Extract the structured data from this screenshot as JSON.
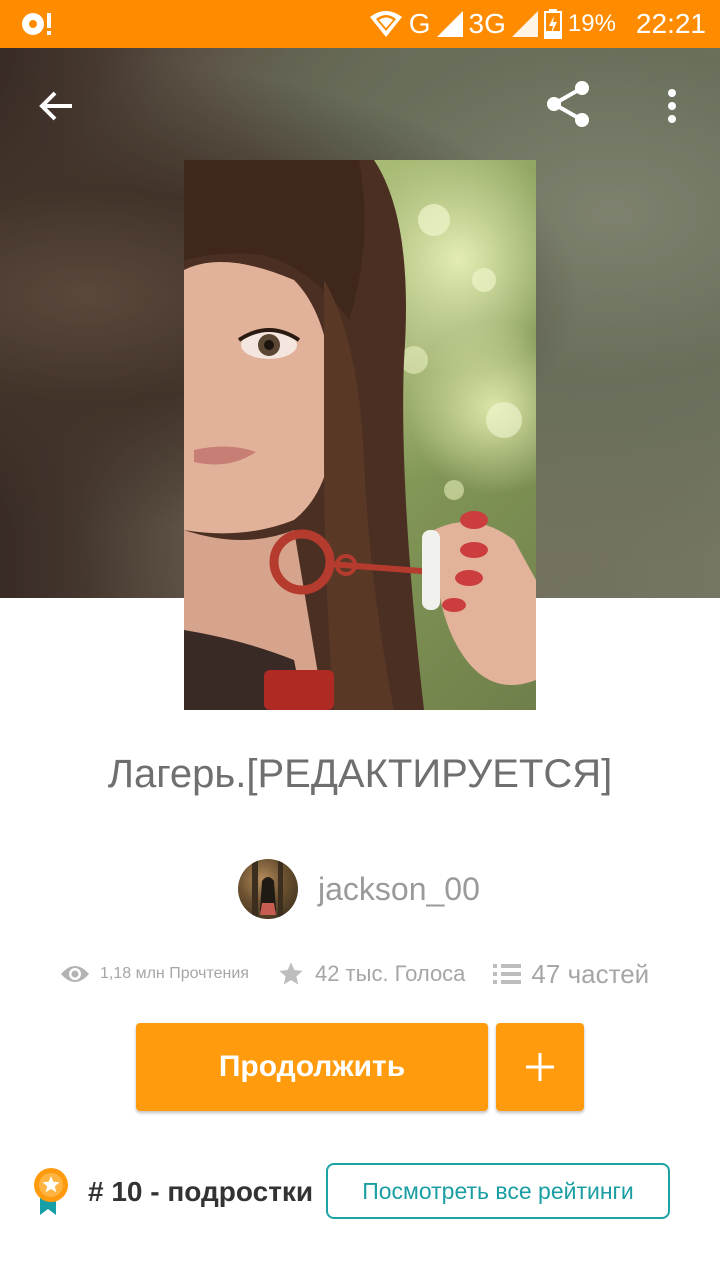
{
  "status_bar": {
    "network_g": "G",
    "network_3g": "3G",
    "battery": "19%",
    "time": "22:21"
  },
  "toolbar": {
    "back_icon": "arrow-left-icon",
    "share_icon": "share-icon",
    "more_icon": "more-vertical-icon"
  },
  "story": {
    "title": "Лагерь.[РЕДАКТИРУЕТСЯ]",
    "author": "jackson_00",
    "reads": "1,18 млн Прочтения",
    "votes": "42 тыс. Голоса",
    "parts": "47 частей"
  },
  "actions": {
    "continue_label": "Продолжить",
    "add_icon": "plus-icon"
  },
  "ranking": {
    "text": "# 10 - подростки",
    "view_all_label": "Посмотреть все рейтинги"
  },
  "colors": {
    "status_bar": "#ff8c00",
    "accent": "#ff9b0d",
    "teal": "#1da2a6"
  }
}
